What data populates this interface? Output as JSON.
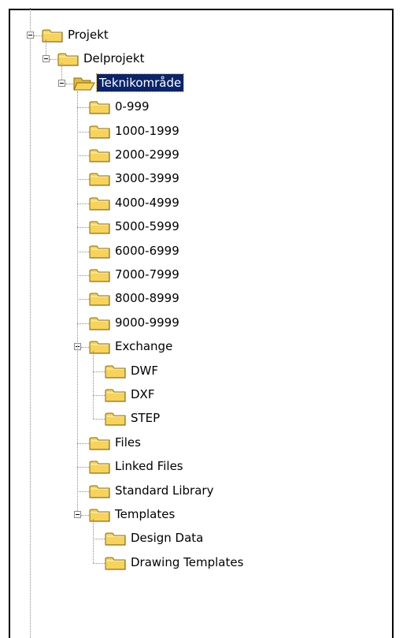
{
  "tree": {
    "root": {
      "label": "Projekt",
      "expanded": true
    },
    "sub": {
      "label": "Delprojekt",
      "expanded": true
    },
    "selected": {
      "label": "Teknikområde",
      "expanded": true
    },
    "ranges": [
      "0-999",
      "1000-1999",
      "2000-2999",
      "3000-3999",
      "4000-4999",
      "5000-5999",
      "6000-6999",
      "7000-7999",
      "8000-8999",
      "9000-9999"
    ],
    "exchange": {
      "label": "Exchange",
      "expanded": true,
      "children": [
        "DWF",
        "DXF",
        "STEP"
      ]
    },
    "leaves": [
      "Files",
      "Linked Files",
      "Standard Library"
    ],
    "templates": {
      "label": "Templates",
      "expanded": true,
      "children": [
        "Design Data",
        "Drawing Templates"
      ]
    }
  },
  "colors": {
    "selection": "#0a246a",
    "folder": "#f7d35b",
    "folder_edge": "#8a6a00"
  }
}
